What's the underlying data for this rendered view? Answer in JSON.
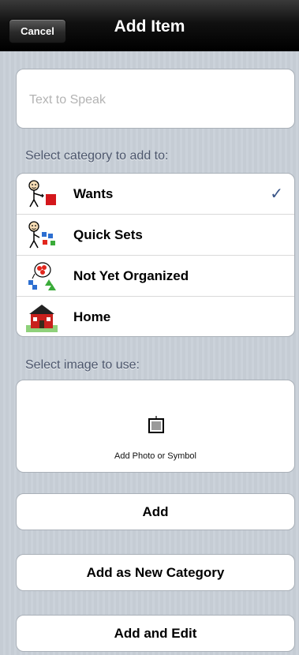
{
  "navbar": {
    "cancel_label": "Cancel",
    "title": "Add Item"
  },
  "text_field": {
    "placeholder": "Text to Speak",
    "value": ""
  },
  "category_section": {
    "label": "Select category to add to:",
    "items": [
      {
        "label": "Wants",
        "icon": "wants-symbol-icon",
        "selected": true
      },
      {
        "label": "Quick Sets",
        "icon": "quick-sets-symbol-icon",
        "selected": false
      },
      {
        "label": "Not Yet Organized",
        "icon": "not-yet-organized-symbol-icon",
        "selected": false
      },
      {
        "label": "Home",
        "icon": "home-symbol-icon",
        "selected": false
      }
    ],
    "checkmark": "✓"
  },
  "image_section": {
    "label": "Select image to use:",
    "caption": "Add Photo or Symbol",
    "icon": "picture-frame-icon"
  },
  "buttons": {
    "add": "Add",
    "add_as_new_category": "Add as New Category",
    "add_and_edit": "Add and Edit"
  },
  "colors": {
    "navbar": "#000000",
    "background": "#c5ccd4",
    "section_label": "#4c566c",
    "checkmark": "#385487"
  }
}
